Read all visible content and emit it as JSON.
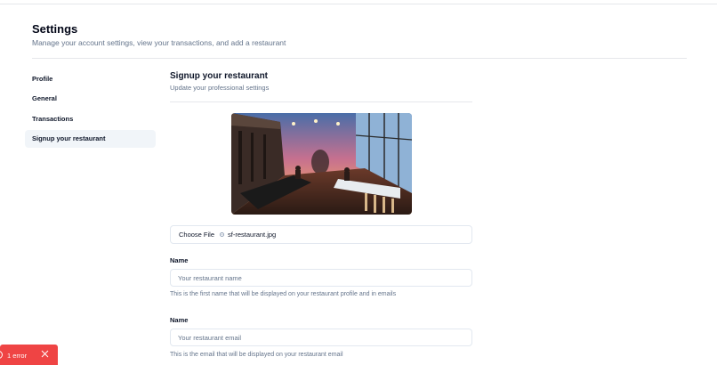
{
  "header": {
    "title": "Settings",
    "subtitle": "Manage your account settings, view your transactions, and add a restaurant"
  },
  "sidebar": {
    "items": [
      {
        "label": "Profile",
        "active": false
      },
      {
        "label": "General",
        "active": false
      },
      {
        "label": "Transactions",
        "active": false
      },
      {
        "label": "Signup your restaurant",
        "active": true
      }
    ]
  },
  "section": {
    "title": "Signup your restaurant",
    "subtitle": "Update your professional settings"
  },
  "upload": {
    "button_label": "Choose File",
    "file_name": "sf-restaurant.jpg"
  },
  "fields": [
    {
      "label": "Name",
      "placeholder": "Your restaurant name",
      "help": "This is the first name that will be displayed on your restaurant profile and in emails"
    },
    {
      "label": "Name",
      "placeholder": "Your restaurant email",
      "help": "This is the email that will be displayed on your restaurant email"
    }
  ],
  "error_toast": {
    "label": "1 error",
    "color": "#ef4444"
  }
}
